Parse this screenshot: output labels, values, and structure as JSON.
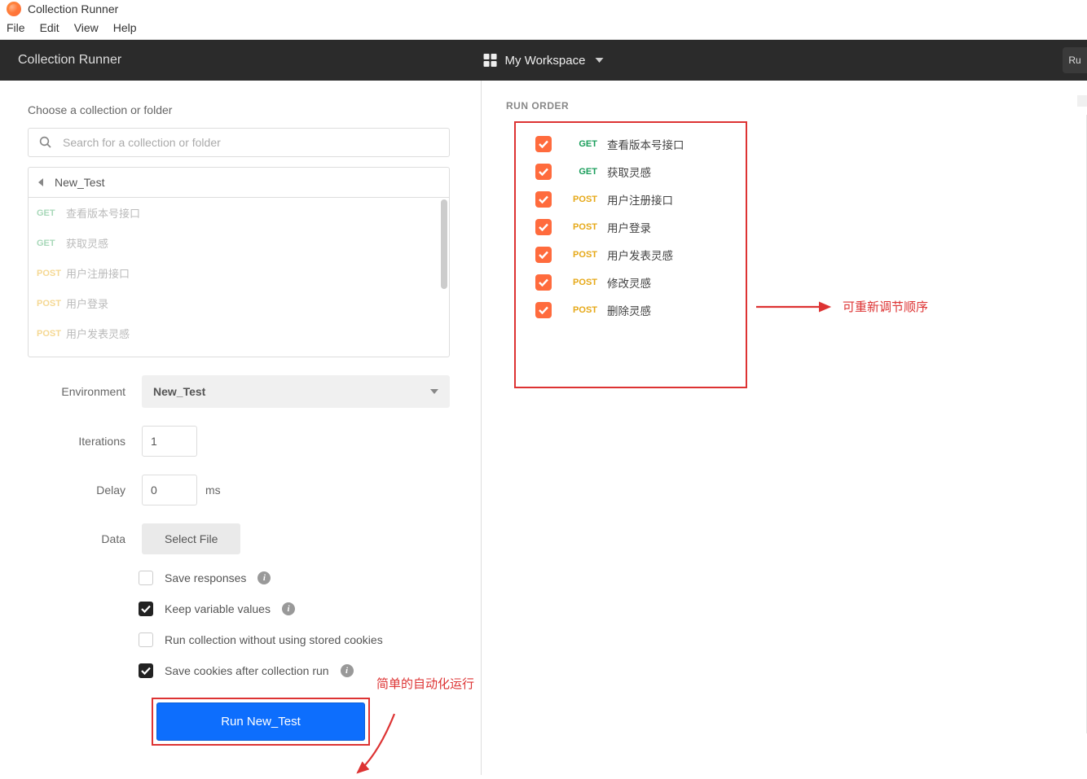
{
  "app": {
    "title": "Collection Runner"
  },
  "menubar": [
    "File",
    "Edit",
    "View",
    "Help"
  ],
  "header": {
    "title": "Collection Runner",
    "workspace": "My Workspace",
    "right_btn": "Ru"
  },
  "left": {
    "choose_label": "Choose a collection or folder",
    "search_placeholder": "Search for a collection or folder",
    "collection_name": "New_Test",
    "requests": [
      {
        "method": "GET",
        "name": "查看版本号接口"
      },
      {
        "method": "GET",
        "name": "获取灵感"
      },
      {
        "method": "POST",
        "name": "用户注册接口"
      },
      {
        "method": "POST",
        "name": "用户登录"
      },
      {
        "method": "POST",
        "name": "用户发表灵感"
      }
    ],
    "env_label": "Environment",
    "env_value": "New_Test",
    "iter_label": "Iterations",
    "iter_value": "1",
    "delay_label": "Delay",
    "delay_value": "0",
    "delay_unit": "ms",
    "data_label": "Data",
    "file_btn": "Select File",
    "opt1": "Save responses",
    "opt2": "Keep variable values",
    "opt3": "Run collection without using stored cookies",
    "opt4": "Save cookies after collection run",
    "run_btn": "Run New_Test"
  },
  "right": {
    "header": "RUN ORDER",
    "items": [
      {
        "method": "GET",
        "name": "查看版本号接口"
      },
      {
        "method": "GET",
        "name": "获取灵感"
      },
      {
        "method": "POST",
        "name": "用户注册接口"
      },
      {
        "method": "POST",
        "name": "用户登录"
      },
      {
        "method": "POST",
        "name": "用户发表灵感"
      },
      {
        "method": "POST",
        "name": "修改灵感"
      },
      {
        "method": "POST",
        "name": "删除灵感"
      }
    ]
  },
  "anno": {
    "a1": "简单的自动化运行",
    "a2": "可重新调节顺序"
  }
}
